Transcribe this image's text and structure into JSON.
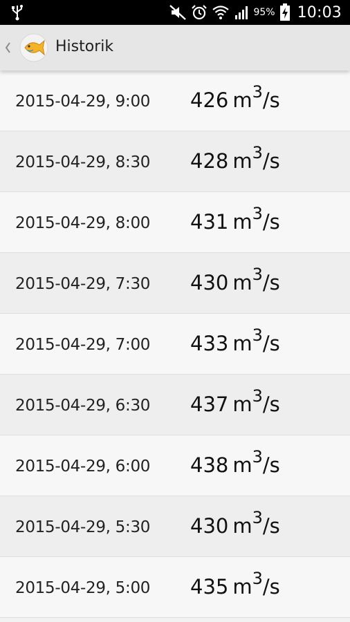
{
  "status_bar": {
    "battery_percent": "95%",
    "time": "10:03",
    "icons": [
      "usb-icon",
      "mute-icon",
      "alarm-icon",
      "wifi-icon",
      "signal-icon",
      "battery-charging-icon"
    ]
  },
  "action_bar": {
    "title": "Historik",
    "icons": [
      "up-caret-icon",
      "fish-logo-icon"
    ]
  },
  "unit": {
    "base": "m",
    "exponent": "3",
    "suffix": "/s"
  },
  "entries": [
    {
      "time": "2015-04-29, 9:00",
      "value": "426"
    },
    {
      "time": "2015-04-29, 8:30",
      "value": "428"
    },
    {
      "time": "2015-04-29, 8:00",
      "value": "431"
    },
    {
      "time": "2015-04-29, 7:30",
      "value": "430"
    },
    {
      "time": "2015-04-29, 7:00",
      "value": "433"
    },
    {
      "time": "2015-04-29, 6:30",
      "value": "437"
    },
    {
      "time": "2015-04-29, 6:00",
      "value": "438"
    },
    {
      "time": "2015-04-29, 5:30",
      "value": "430"
    },
    {
      "time": "2015-04-29, 5:00",
      "value": "435"
    }
  ],
  "colors": {
    "status_bar_bg": "#000000",
    "action_bar_bg": "#e6e6e6",
    "row_light": "#f7f7f7",
    "row_dark": "#eeeeee",
    "logo_fill": "#f5b427"
  }
}
